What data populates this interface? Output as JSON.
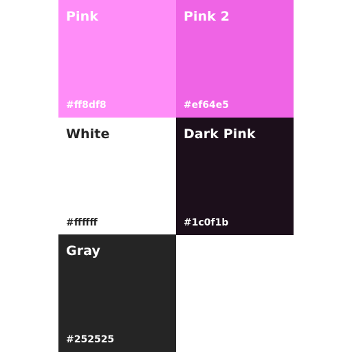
{
  "swatches": [
    {
      "name": "Pink",
      "hex": "#ff8df8",
      "color": "#ff8df8",
      "text_color": "#ffffff"
    },
    {
      "name": "Pink 2",
      "hex": "#ef64e5",
      "color": "#ef64e5",
      "text_color": "#ffffff"
    },
    {
      "name": "White",
      "hex": "#ffffff",
      "color": "#ffffff",
      "text_color": "#252525"
    },
    {
      "name": "Dark Pink",
      "hex": "#1c0f1b",
      "color": "#1c0f1b",
      "text_color": "#ffffff"
    },
    {
      "name": "Gray",
      "hex": "#252525",
      "color": "#252525",
      "text_color": "#ffffff"
    }
  ]
}
